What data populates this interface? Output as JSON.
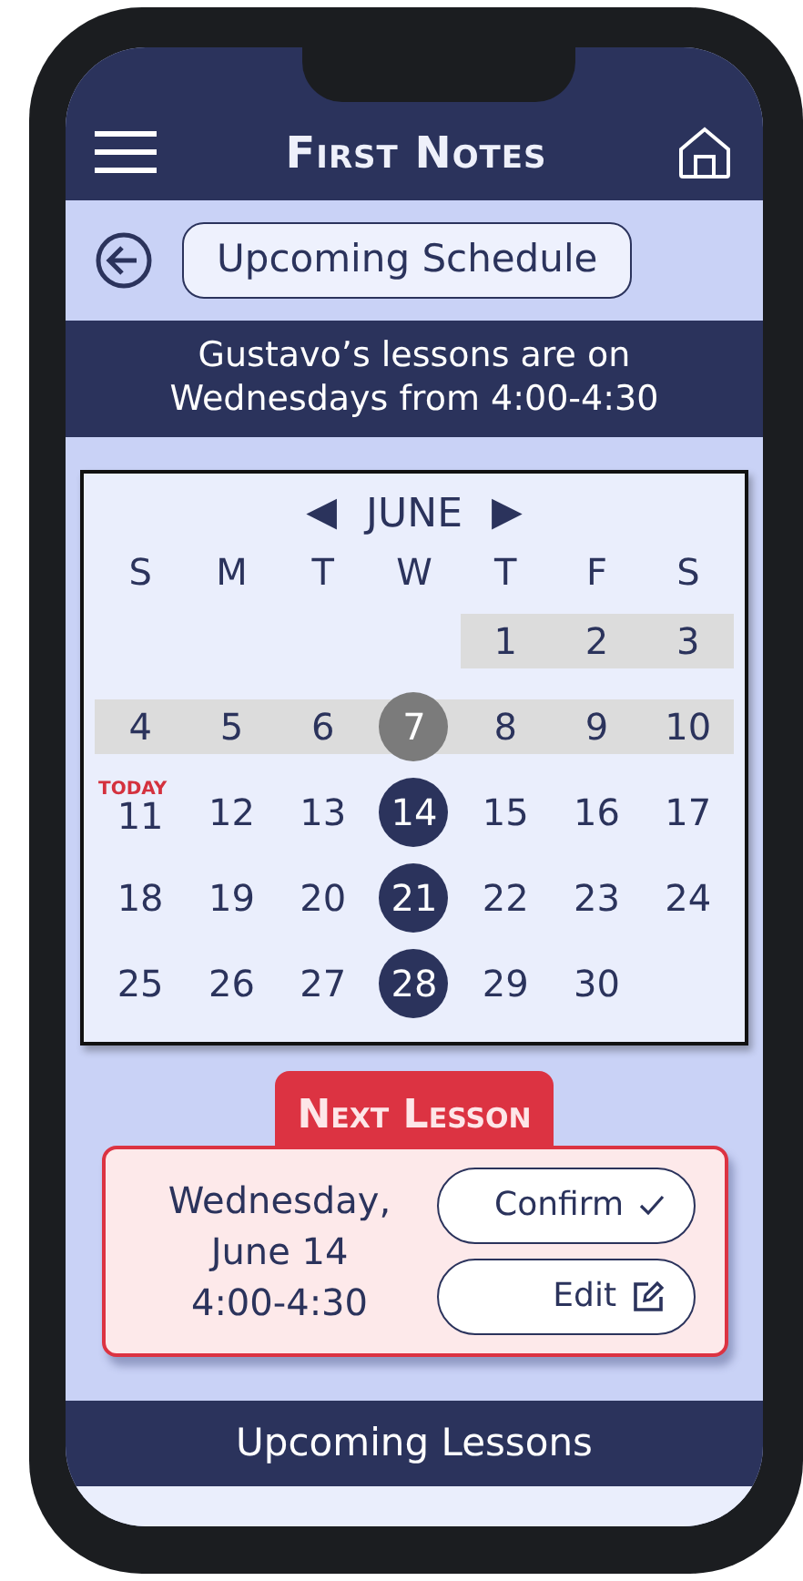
{
  "header": {
    "title": "First Notes"
  },
  "page_title": "Upcoming Schedule",
  "banner": "Gustavo’s lessons are on Wednesdays from 4:00-4:30",
  "calendar": {
    "prev": "◀",
    "month": "JUNE",
    "next": "▶",
    "weekdays": [
      "S",
      "M",
      "T",
      "W",
      "T",
      "F",
      "S"
    ],
    "weeks": [
      {
        "shaded": true,
        "days": [
          {
            "kind": "blank"
          },
          {
            "kind": "blank"
          },
          {
            "kind": "blank"
          },
          {
            "kind": "blank"
          },
          {
            "kind": "plain",
            "text": "1"
          },
          {
            "kind": "plain",
            "text": "2"
          },
          {
            "kind": "plain",
            "text": "3"
          }
        ]
      },
      {
        "shaded": true,
        "days": [
          {
            "kind": "plain",
            "text": "4"
          },
          {
            "kind": "plain",
            "text": "5"
          },
          {
            "kind": "plain",
            "text": "6"
          },
          {
            "kind": "past",
            "text": "7"
          },
          {
            "kind": "plain",
            "text": "8"
          },
          {
            "kind": "plain",
            "text": "9"
          },
          {
            "kind": "plain",
            "text": "10"
          }
        ]
      },
      {
        "shaded": false,
        "days": [
          {
            "kind": "plain",
            "text": "11",
            "label": "TODAY"
          },
          {
            "kind": "plain",
            "text": "12"
          },
          {
            "kind": "plain",
            "text": "13"
          },
          {
            "kind": "lesson",
            "text": "14"
          },
          {
            "kind": "plain",
            "text": "15"
          },
          {
            "kind": "plain",
            "text": "16"
          },
          {
            "kind": "plain",
            "text": "17"
          }
        ]
      },
      {
        "shaded": false,
        "days": [
          {
            "kind": "plain",
            "text": "18"
          },
          {
            "kind": "plain",
            "text": "19"
          },
          {
            "kind": "plain",
            "text": "20"
          },
          {
            "kind": "lesson",
            "text": "21"
          },
          {
            "kind": "plain",
            "text": "22"
          },
          {
            "kind": "plain",
            "text": "23"
          },
          {
            "kind": "plain",
            "text": "24"
          }
        ]
      },
      {
        "shaded": false,
        "days": [
          {
            "kind": "plain",
            "text": "25"
          },
          {
            "kind": "plain",
            "text": "26"
          },
          {
            "kind": "plain",
            "text": "27"
          },
          {
            "kind": "lesson",
            "text": "28"
          },
          {
            "kind": "plain",
            "text": "29"
          },
          {
            "kind": "plain",
            "text": "30"
          }
        ]
      }
    ]
  },
  "next_lesson": {
    "heading": "Next Lesson",
    "date_lines": [
      "Wednesday,",
      "June 14",
      "4:00-4:30"
    ],
    "buttons": [
      {
        "label": "Confirm",
        "kind": "confirm"
      },
      {
        "label": "Edit",
        "kind": "edit"
      }
    ]
  },
  "upcoming": {
    "heading": "Upcoming Lessons"
  }
}
